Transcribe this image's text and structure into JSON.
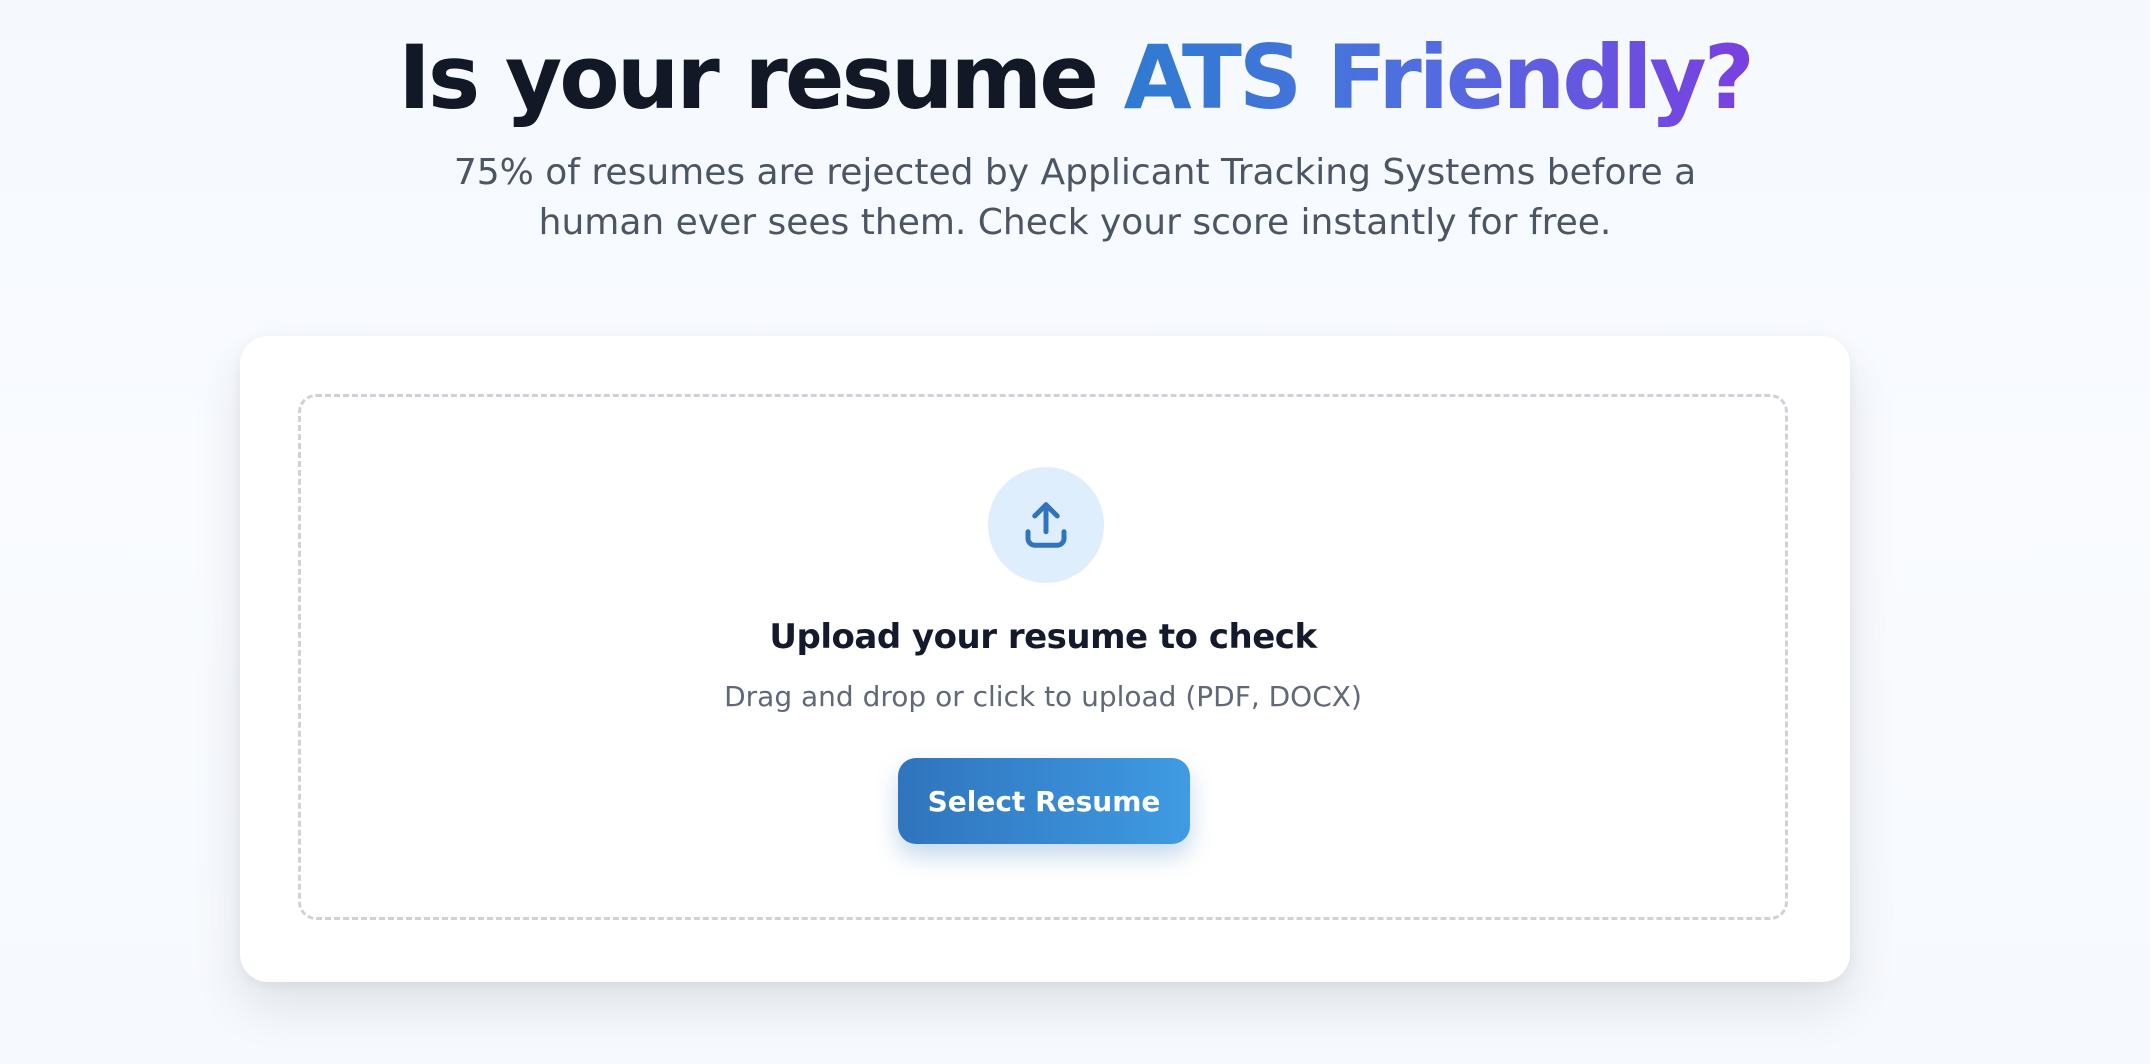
{
  "hero": {
    "headline_prefix": "Is your resume ",
    "headline_accent": "ATS Friendly?",
    "subtitle_line1": "75% of resumes are rejected by Applicant Tracking Systems before a",
    "subtitle_line2": "human ever sees them. Check your score instantly for free."
  },
  "upload": {
    "icon": "upload-icon",
    "title": "Upload your resume to check",
    "subtitle": "Drag and drop or click to upload (PDF, DOCX)",
    "button_label": "Select Resume"
  },
  "colors": {
    "accent_start": "#2f7bd0",
    "accent_end": "#7a3fe0",
    "button_start": "#2f74bd",
    "button_end": "#3f9be3",
    "icon_bg": "#deeefc"
  }
}
